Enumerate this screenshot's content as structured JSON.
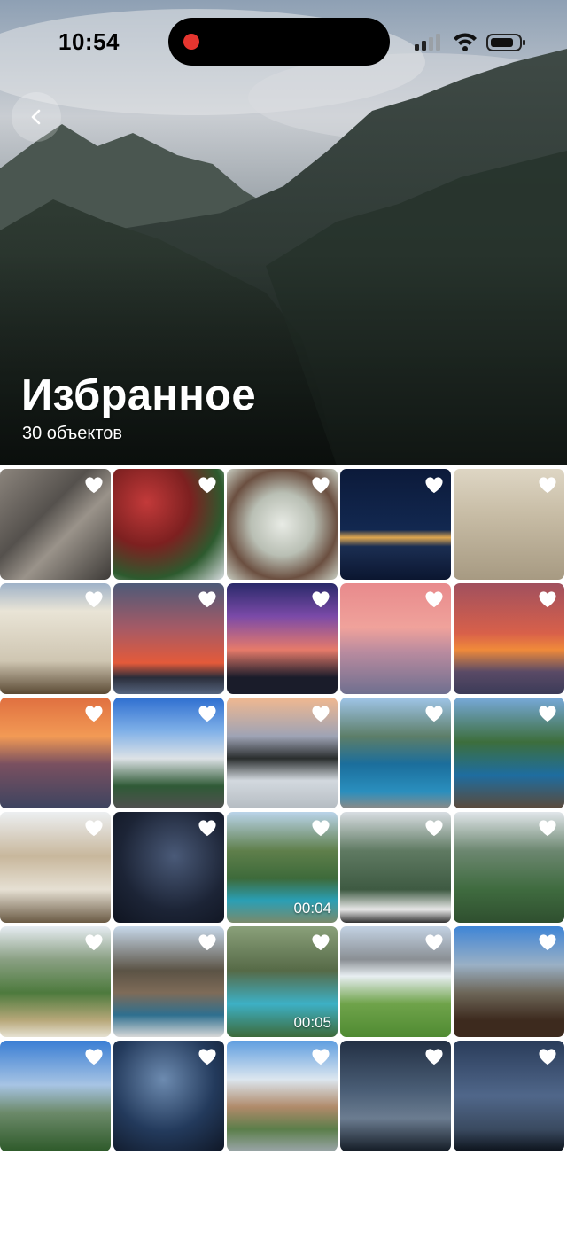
{
  "status_bar": {
    "time": "10:54"
  },
  "header": {
    "back_icon": "chevron-left-icon",
    "title": "Избранное",
    "subtitle": "30 объектов"
  },
  "favorite_icon": "heart-icon",
  "photos": [
    {
      "subject": "rock texture",
      "duration": ""
    },
    {
      "subject": "red plants and lichen",
      "duration": ""
    },
    {
      "subject": "white lichen",
      "duration": ""
    },
    {
      "subject": "night bridge",
      "duration": ""
    },
    {
      "subject": "classical building facade",
      "duration": ""
    },
    {
      "subject": "hall with columns",
      "duration": ""
    },
    {
      "subject": "red sunset over city",
      "duration": ""
    },
    {
      "subject": "sunset from terrace",
      "duration": ""
    },
    {
      "subject": "pink sunset over sea",
      "duration": ""
    },
    {
      "subject": "orange sunset over sea",
      "duration": ""
    },
    {
      "subject": "orange sunset clouds",
      "duration": ""
    },
    {
      "subject": "house with palm",
      "duration": ""
    },
    {
      "subject": "sea of clouds",
      "duration": ""
    },
    {
      "subject": "coast with pool ladder",
      "duration": ""
    },
    {
      "subject": "green cliffs coast",
      "duration": ""
    },
    {
      "subject": "table with food",
      "duration": ""
    },
    {
      "subject": "night sky with stars",
      "duration": ""
    },
    {
      "subject": "lagoon and cliffs video",
      "duration": "00:04"
    },
    {
      "subject": "mountains with car",
      "duration": ""
    },
    {
      "subject": "green mountain valley",
      "duration": ""
    },
    {
      "subject": "green hills village",
      "duration": ""
    },
    {
      "subject": "rocky coast",
      "duration": ""
    },
    {
      "subject": "turquoise lake video",
      "duration": "00:05"
    },
    {
      "subject": "alpine meadow",
      "duration": ""
    },
    {
      "subject": "alpine waterfall village",
      "duration": ""
    },
    {
      "subject": "alpine pines",
      "duration": ""
    },
    {
      "subject": "milky way over rocks",
      "duration": ""
    },
    {
      "subject": "river village",
      "duration": ""
    },
    {
      "subject": "milky way sky",
      "duration": ""
    },
    {
      "subject": "starry sky with trees",
      "duration": ""
    }
  ]
}
